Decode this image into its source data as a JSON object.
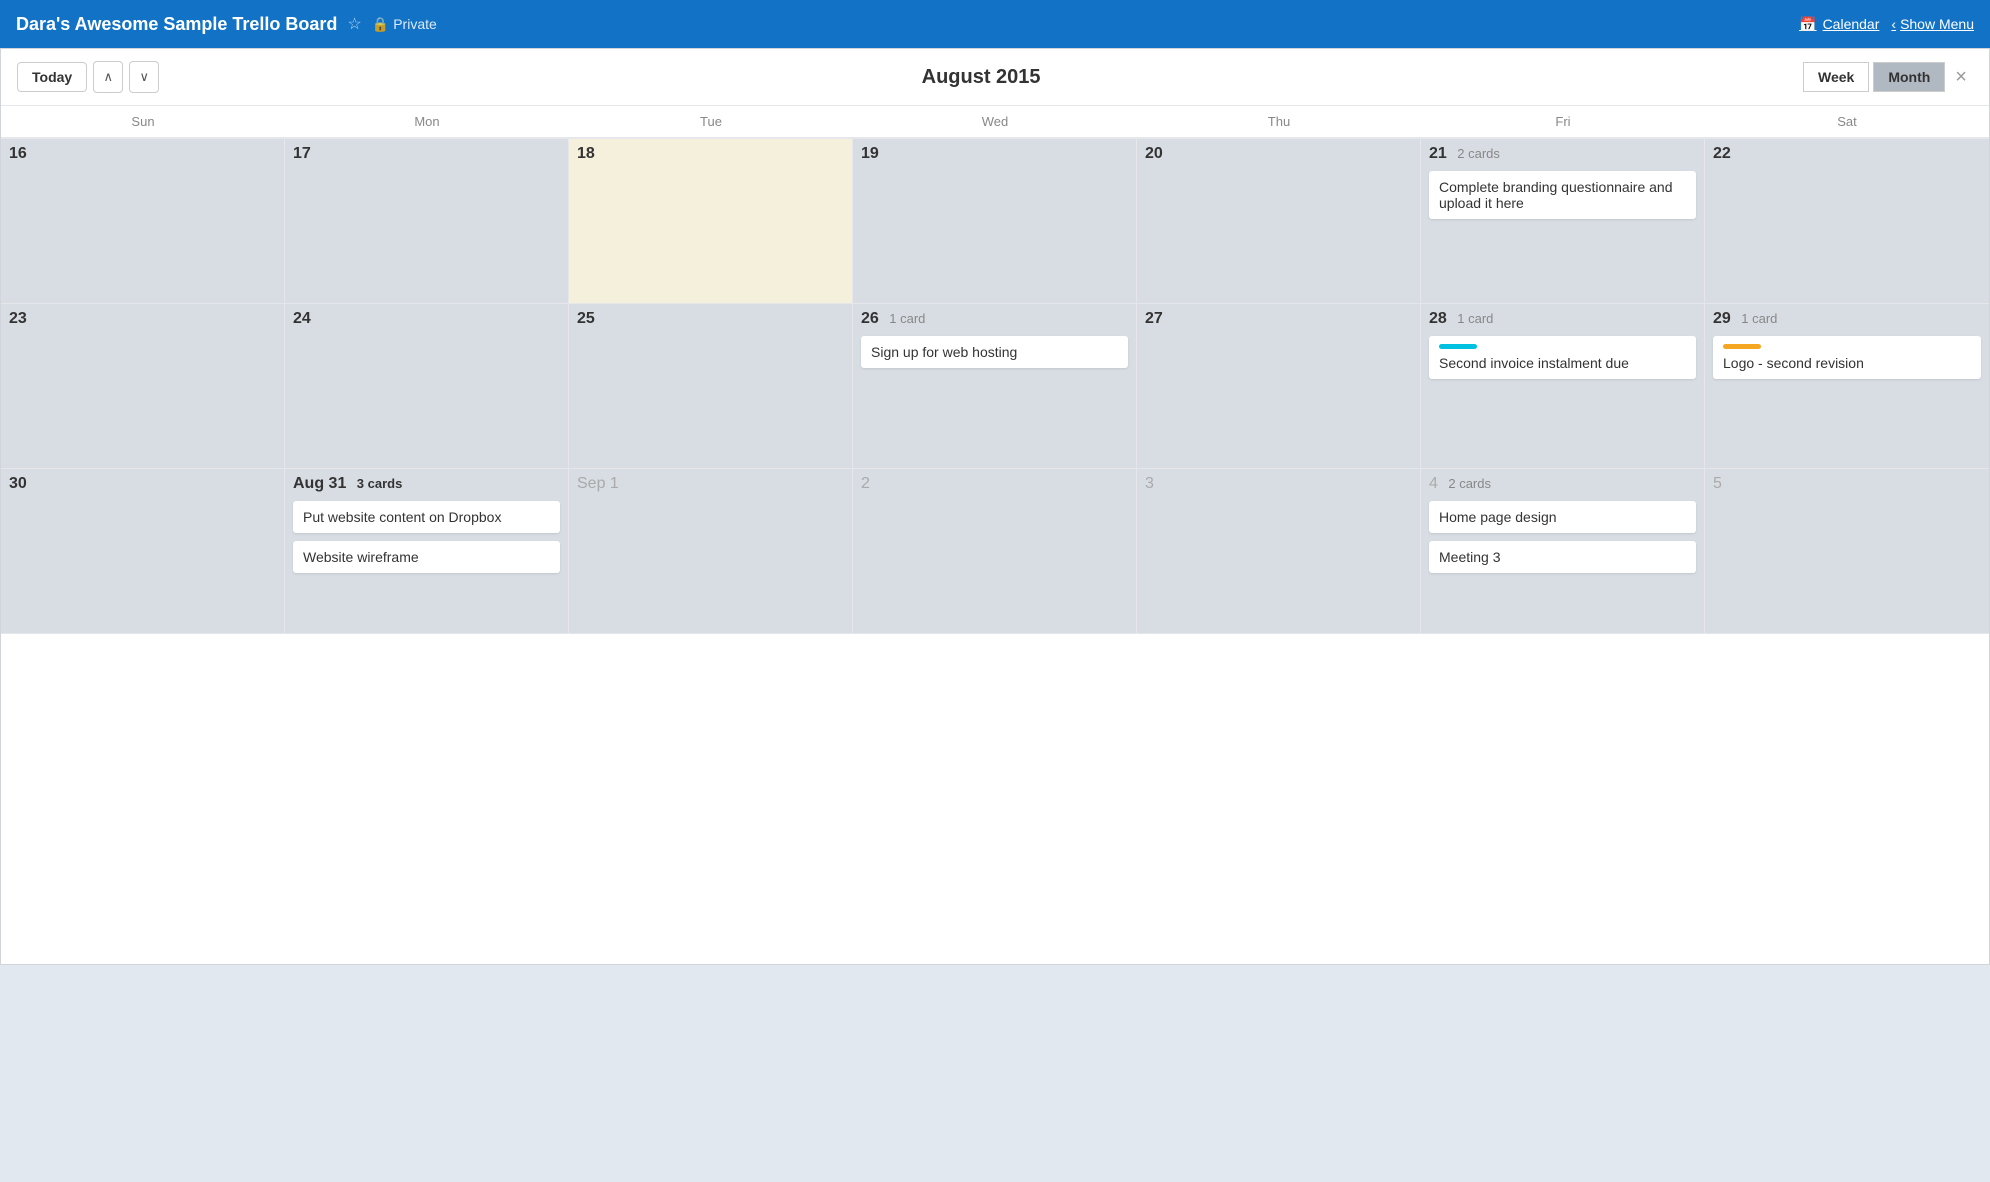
{
  "topbar": {
    "title": "Dara's Awesome Sample Trello Board",
    "star_icon": "☆",
    "lock_icon": "🔒",
    "private_label": "Private",
    "calendar_icon": "📅",
    "calendar_label": "Calendar",
    "chevron_left": "‹",
    "show_menu_label": "Show Menu"
  },
  "calendar": {
    "nav": {
      "today_label": "Today",
      "arrow_up": "∧",
      "arrow_down": "∨",
      "title": "August 2015",
      "week_label": "Week",
      "month_label": "Month",
      "close_icon": "×"
    },
    "day_headers": [
      "Sun",
      "Mon",
      "Tue",
      "Wed",
      "Thu",
      "Fri",
      "Sat"
    ],
    "rows": [
      [
        {
          "day": "16",
          "other": false,
          "today": false,
          "cards": []
        },
        {
          "day": "17",
          "other": false,
          "today": false,
          "cards": []
        },
        {
          "day": "18",
          "other": false,
          "today": true,
          "cards": []
        },
        {
          "day": "19",
          "other": false,
          "today": false,
          "cards": []
        },
        {
          "day": "20",
          "other": false,
          "today": false,
          "cards": []
        },
        {
          "day": "21",
          "other": false,
          "today": false,
          "card_count": "2 cards",
          "cards": [
            {
              "text": "Complete branding questionnaire and upload it here",
              "label": null
            }
          ]
        },
        {
          "day": "22",
          "other": false,
          "today": false,
          "cards": []
        }
      ],
      [
        {
          "day": "23",
          "other": false,
          "today": false,
          "cards": []
        },
        {
          "day": "24",
          "other": false,
          "today": false,
          "cards": []
        },
        {
          "day": "25",
          "other": false,
          "today": false,
          "cards": []
        },
        {
          "day": "26",
          "other": false,
          "today": false,
          "card_count": "1 card",
          "cards": [
            {
              "text": "Sign up for web hosting",
              "label": null
            }
          ]
        },
        {
          "day": "27",
          "other": false,
          "today": false,
          "cards": []
        },
        {
          "day": "28",
          "other": false,
          "today": false,
          "card_count": "1 card",
          "cards": [
            {
              "text": "Second invoice instalment due",
              "label": "cyan"
            }
          ]
        },
        {
          "day": "29",
          "other": false,
          "today": false,
          "card_count": "1 card",
          "cards": [
            {
              "text": "Logo - second revision",
              "label": "yellow"
            }
          ]
        }
      ],
      [
        {
          "day": "30",
          "other": false,
          "today": false,
          "cards": []
        },
        {
          "day": "Aug 31",
          "other": false,
          "today": false,
          "bold": true,
          "card_count": "3 cards",
          "cards": [
            {
              "text": "Put website content on Dropbox",
              "label": null
            },
            {
              "text": "Website wireframe",
              "label": null
            }
          ]
        },
        {
          "day": "Sep 1",
          "other": true,
          "today": false,
          "cards": []
        },
        {
          "day": "2",
          "other": true,
          "today": false,
          "cards": []
        },
        {
          "day": "3",
          "other": true,
          "today": false,
          "cards": []
        },
        {
          "day": "4",
          "other": true,
          "today": false,
          "card_count": "2 cards",
          "cards": [
            {
              "text": "Home page design",
              "label": null
            },
            {
              "text": "Meeting 3",
              "label": null
            }
          ]
        },
        {
          "day": "5",
          "other": true,
          "today": false,
          "cards": []
        }
      ]
    ]
  }
}
